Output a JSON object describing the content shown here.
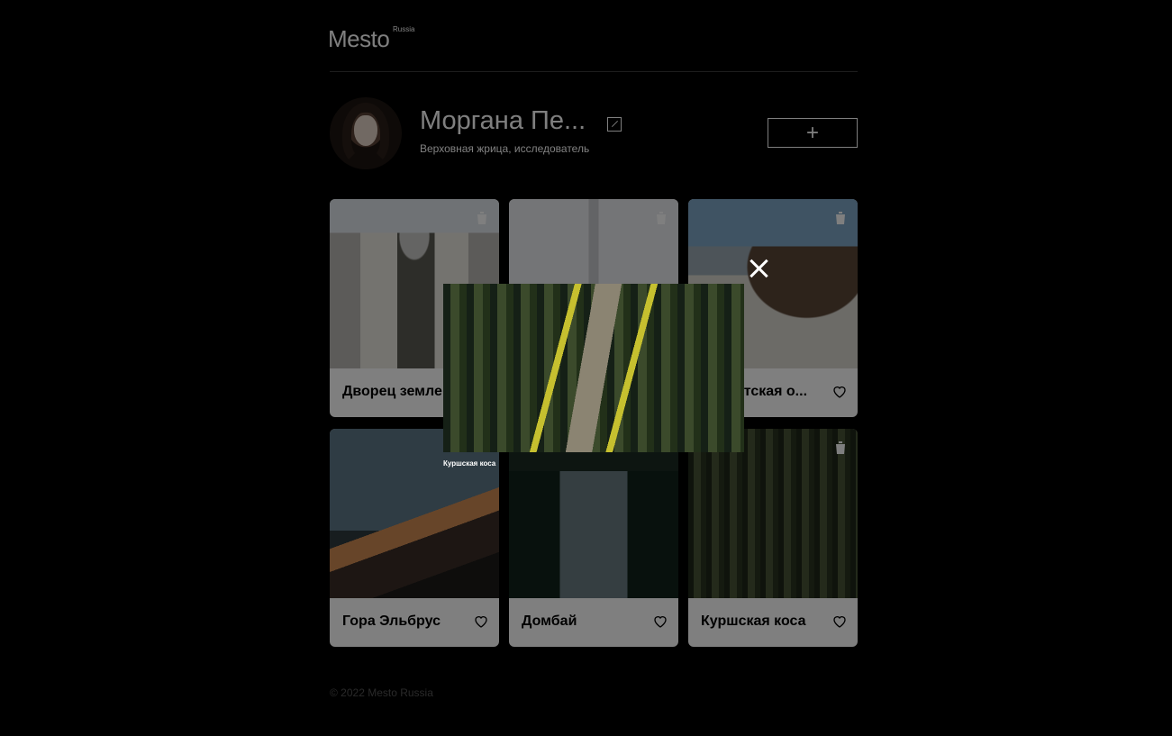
{
  "header": {
    "logo": "Mesto",
    "logo_sup": "Russia"
  },
  "profile": {
    "name": "Моргана Пе...",
    "about": "Верховная жрица, исследователь",
    "add_button_label": "+"
  },
  "cards": [
    {
      "title": "Дворец земледельцев",
      "image": "palace"
    },
    {
      "title": "",
      "image": "obelisk"
    },
    {
      "title": "Атлантская о...",
      "image": "coast"
    },
    {
      "title": "Гора Эльбрус",
      "image": "elbrus"
    },
    {
      "title": "Домбай",
      "image": "dombay"
    },
    {
      "title": "Куршская коса",
      "image": "forest"
    }
  ],
  "popup": {
    "caption": "Куршская коса",
    "image": "forest-path"
  },
  "footer": {
    "text": "© 2022 Mesto Russia"
  },
  "icons": {
    "edit": "pencil-icon",
    "add": "plus-icon",
    "like": "heart-icon",
    "trash": "trash-icon",
    "close": "close-icon"
  },
  "colors": {
    "background": "#000000",
    "card": "#ffffff",
    "overlay": "rgba(0,0,0,0.5)"
  }
}
